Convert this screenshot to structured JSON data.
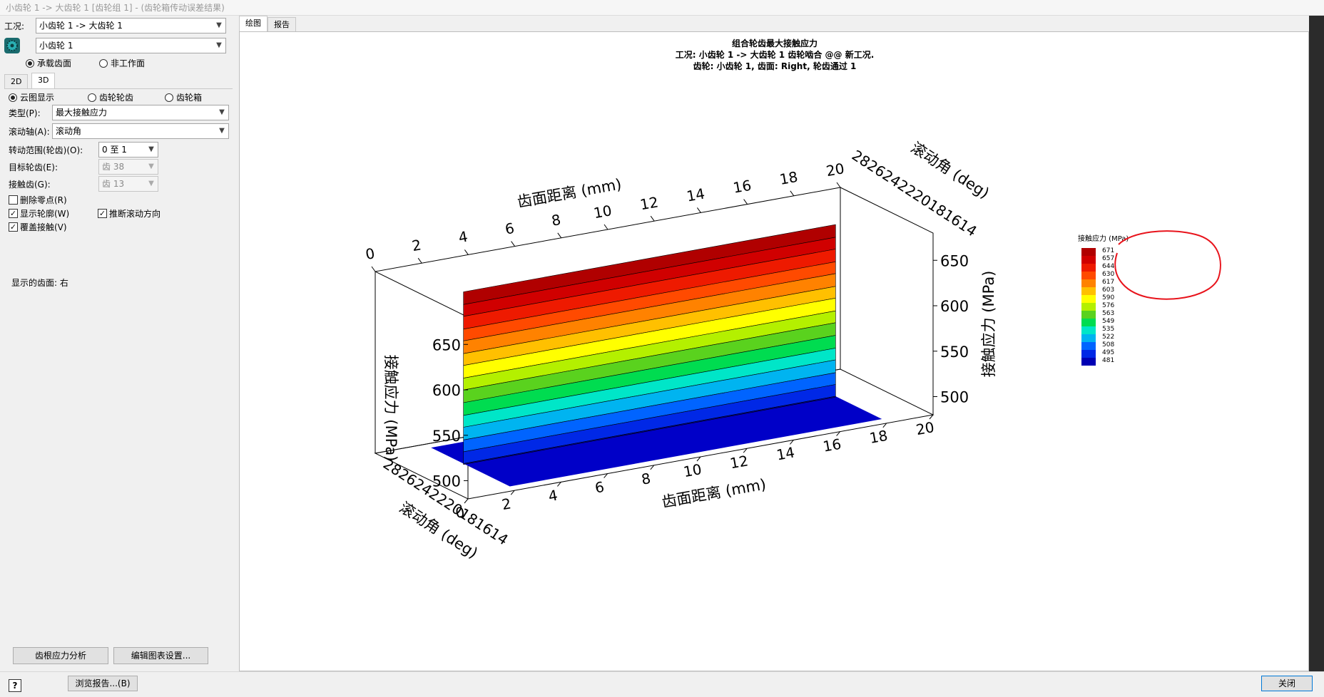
{
  "window": {
    "title": "小齿轮 1 -> 大齿轮 1 [齿轮组 1] - (齿轮箱传动误差结果)"
  },
  "left": {
    "condition_label": "工况:",
    "condition_value": "小齿轮 1 -> 大齿轮 1",
    "gear_value": "小齿轮 1",
    "flank_options": [
      "承载齿面",
      "非工作面"
    ],
    "view_tabs": [
      "2D",
      "3D"
    ],
    "display_options": [
      "云图显示",
      "齿轮轮齿",
      "齿轮箱"
    ],
    "type_label": "类型(P):",
    "type_value": "最大接触应力",
    "roll_axis_label": "滚动轴(A):",
    "roll_axis_value": "滚动角",
    "rotation_label": "转动范围(轮齿)(O):",
    "rotation_value": "0 至 1",
    "target_label": "目标轮齿(E):",
    "target_value": "齿 38",
    "contact_label": "接触齿(G):",
    "contact_value": "齿 13",
    "checks": {
      "delete_zero": "删除零点(R)",
      "show_profile": "显示轮廓(W)",
      "cover_contact": "覆盖接触(V)",
      "infer_roll": "推断滚动方向"
    },
    "shown_flank": "显示的齿面: 右",
    "root_stress_button": "齿根应力分析",
    "edit_chart_button": "编辑图表设置..."
  },
  "main_tabs": [
    "绘图",
    "报告"
  ],
  "bottom": {
    "help_icon": "?",
    "browse_report_button": "浏览报告...(B)",
    "close_button": "关闭"
  },
  "colors": {
    "accent": "#0078d7",
    "annotation": "#e8131b"
  },
  "chart_data": {
    "type": "surface3d",
    "title": "组合轮齿最大接触应力",
    "subtitle_lines": [
      "工况: 小齿轮 1 -> 大齿轮 1 齿轮啮合 @@ 新工况.",
      "齿轮: 小齿轮 1, 齿面: Right, 轮齿通过 1"
    ],
    "x_axis": {
      "label": "齿面距离 (mm)",
      "ticks": [
        "0",
        "2",
        "4",
        "6",
        "8",
        "10",
        "12",
        "14",
        "16",
        "18",
        "20"
      ],
      "range": [
        0,
        20
      ]
    },
    "y_axis": {
      "label": "滚动角 (deg)",
      "tick_text": "2826242220181614",
      "range": [
        14,
        28
      ]
    },
    "z_axis": {
      "label": "接触应力 (MPa)",
      "ticks": [
        "500",
        "550",
        "600",
        "650"
      ],
      "range": [
        480,
        680
      ]
    },
    "surface": {
      "x_range": [
        2,
        18
      ],
      "z_max": 671,
      "z_min": 481
    },
    "legend": {
      "title": "接触应力 (MPa)",
      "placement": "right",
      "levels": [
        "671",
        "657",
        "644",
        "630",
        "617",
        "603",
        "590",
        "576",
        "563",
        "549",
        "535",
        "522",
        "508",
        "495",
        "481"
      ],
      "colors": [
        "#b00000",
        "#d00000",
        "#ee1a00",
        "#ff4a00",
        "#ff8200",
        "#ffc000",
        "#ffff00",
        "#b4f000",
        "#5ad21e",
        "#00dc50",
        "#00e6c8",
        "#00b4f0",
        "#0064ff",
        "#0028e6",
        "#0000b4"
      ]
    }
  }
}
